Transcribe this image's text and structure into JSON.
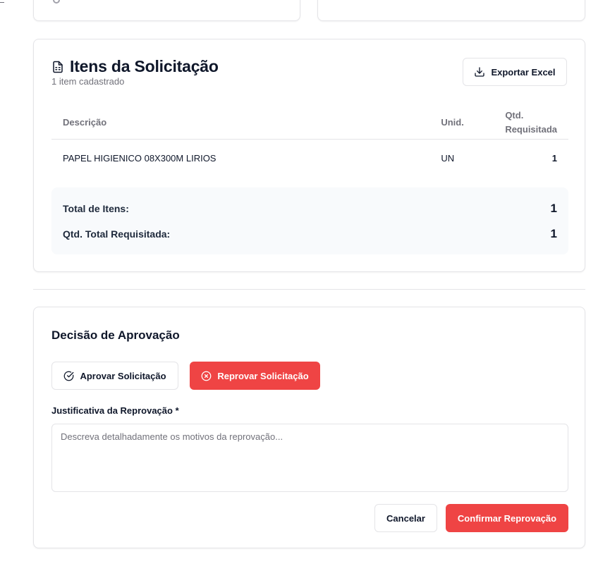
{
  "items_section": {
    "title": "Itens da Solicitação",
    "subtitle": "1 item cadastrado",
    "export_label": "Exportar Excel",
    "columns": {
      "descricao": "Descrição",
      "unid": "Unid.",
      "qtd_line1": "Qtd.",
      "qtd_line2": "Requisitada"
    },
    "rows": [
      {
        "descricao": "PAPEL HIGIENICO 08X300M LIRIOS",
        "unid": "UN",
        "qtd": "1"
      }
    ],
    "totals": {
      "total_itens_label": "Total de Itens:",
      "total_itens_value": "1",
      "qtd_total_label": "Qtd. Total Requisitada:",
      "qtd_total_value": "1"
    }
  },
  "approval": {
    "title": "Decisão de Aprovação",
    "approve_label": "Aprovar Solicitação",
    "reject_label": "Reprovar Solicitação",
    "justification_label": "Justificativa da Reprovação *",
    "justification_placeholder": "Descreva detalhadamente os motivos da reprovação...",
    "justification_value": "",
    "cancel_label": "Cancelar",
    "confirm_label": "Confirmar Reprovação"
  },
  "icons": {
    "title_icon": "file-spreadsheet-icon",
    "export_icon": "download-icon",
    "approve_icon": "check-circle-icon",
    "reject_icon": "x-circle-icon"
  },
  "colors": {
    "danger": "#ef4444",
    "border": "#e4e4e7",
    "muted_text": "#71717a",
    "totals_bg": "#f8fafc"
  }
}
